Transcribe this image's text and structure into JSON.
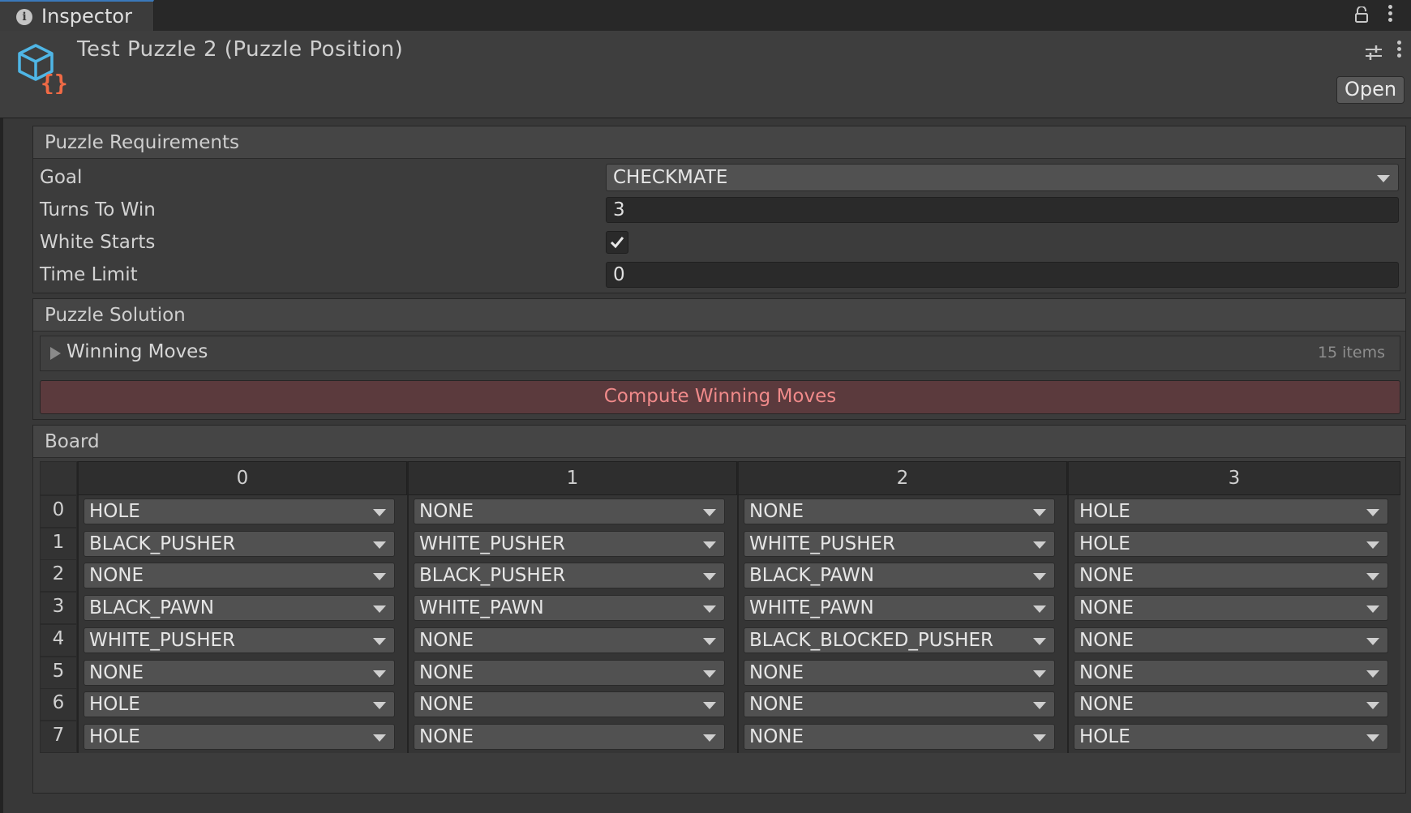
{
  "tab": {
    "label": "Inspector",
    "icon": "info-icon"
  },
  "header": {
    "title": "Test Puzzle 2 (Puzzle Position)",
    "icon": "script-asset-icon",
    "open_label": "Open"
  },
  "requirements": {
    "title": "Puzzle Requirements",
    "goal_label": "Goal",
    "goal_value": "CHECKMATE",
    "turns_label": "Turns To Win",
    "turns_value": "3",
    "white_starts_label": "White Starts",
    "white_starts_checked": true,
    "time_label": "Time Limit",
    "time_value": "0"
  },
  "solution": {
    "title": "Puzzle Solution",
    "moves_label": "Winning Moves",
    "moves_count": "15 items",
    "compute_label": "Compute Winning Moves"
  },
  "board": {
    "title": "Board",
    "columns": [
      "0",
      "1",
      "2",
      "3"
    ],
    "rows": [
      {
        "index": "0",
        "cells": [
          "HOLE",
          "NONE",
          "NONE",
          "HOLE"
        ]
      },
      {
        "index": "1",
        "cells": [
          "BLACK_PUSHER",
          "WHITE_PUSHER",
          "WHITE_PUSHER",
          "HOLE"
        ]
      },
      {
        "index": "2",
        "cells": [
          "NONE",
          "BLACK_PUSHER",
          "BLACK_PAWN",
          "NONE"
        ]
      },
      {
        "index": "3",
        "cells": [
          "BLACK_PAWN",
          "WHITE_PAWN",
          "WHITE_PAWN",
          "NONE"
        ]
      },
      {
        "index": "4",
        "cells": [
          "WHITE_PUSHER",
          "NONE",
          "BLACK_BLOCKED_PUSHER",
          "NONE"
        ]
      },
      {
        "index": "5",
        "cells": [
          "NONE",
          "NONE",
          "NONE",
          "NONE"
        ]
      },
      {
        "index": "6",
        "cells": [
          "HOLE",
          "NONE",
          "NONE",
          "NONE"
        ]
      },
      {
        "index": "7",
        "cells": [
          "HOLE",
          "NONE",
          "NONE",
          "HOLE"
        ]
      }
    ]
  },
  "colors": {
    "background": "#383838",
    "accent_tab": "#3a79bb",
    "compute_button_bg": "#5b3a3d",
    "compute_button_text": "#f08a8a"
  }
}
